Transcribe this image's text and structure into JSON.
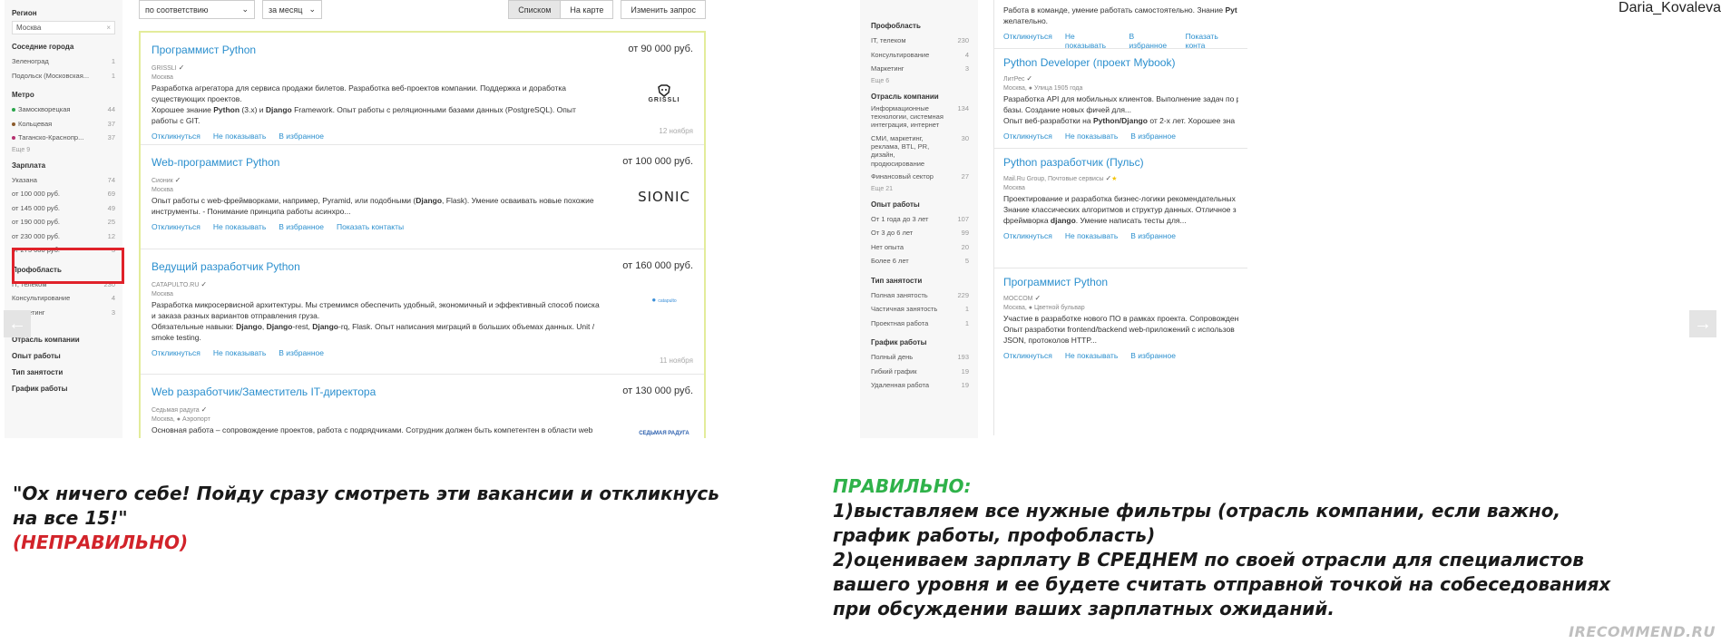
{
  "left": {
    "filters": {
      "region_title": "Регион",
      "region_value": "Москва",
      "region_clear": "×",
      "neighbors_title": "Соседние города",
      "neighbors": [
        {
          "label": "Зеленоград",
          "count": "1"
        },
        {
          "label": "Подольск (Московская...",
          "count": "1"
        }
      ],
      "metro_title": "Метро",
      "metro": [
        {
          "label": "Замоскворецкая",
          "count": "44",
          "color": "#2aa44a"
        },
        {
          "label": "Кольцевая",
          "count": "37",
          "color": "#8b5a2b"
        },
        {
          "label": "Таганско-Краснопр...",
          "count": "37",
          "color": "#b5306f"
        }
      ],
      "metro_more": "Еще 9",
      "salary_title": "Зарплата",
      "salary": [
        {
          "label": "Указана",
          "count": "74"
        },
        {
          "label": "от 100 000 руб.",
          "count": "69"
        },
        {
          "label": "от 145 000 руб.",
          "count": "49"
        },
        {
          "label": "от 190 000 руб.",
          "count": "25"
        },
        {
          "label": "от 230 000 руб.",
          "count": "12"
        },
        {
          "label": "от 275 000 руб.",
          "count": "3"
        }
      ],
      "prof_title": "Профобласть",
      "prof": [
        {
          "label": "IT, телеком",
          "count": "230"
        },
        {
          "label": "Консультирование",
          "count": "4"
        },
        {
          "label": "Маркетинг",
          "count": "3"
        }
      ],
      "prof_more": "Еще 6",
      "industry_title": "Отрасль компании",
      "experience_title": "Опыт работы",
      "employment_title": "Тип занятости",
      "schedule_title": "График работы"
    },
    "toolbar": {
      "sort": "по соответствию",
      "period": "за месяц",
      "view_list": "Списком",
      "view_map": "На карте",
      "change_query": "Изменить запрос"
    },
    "vacancies": [
      {
        "title": "Программист Python",
        "salary": "от 90 000 руб.",
        "company": "GRISSLI",
        "city": "Москва",
        "desc_html": "Разработка агрегатора для сервиса продажи билетов. Разработка веб-проектов компании. Поддержка и доработка существующих проектов.<br>Хорошее знание <b>Python</b> (3.x) и <b>Django</b> Framework. Опыт работы с реляционными базами данных (PostgreSQL). Опыт работы с GIT.",
        "actions": [
          "Откликнуться",
          "Не показывать",
          "В избранное"
        ],
        "date": "12 ноября",
        "logo": "GRISSLI"
      },
      {
        "title": "Web-программист Python",
        "salary": "от 100 000 руб.",
        "company": "Сионик",
        "city": "Москва",
        "desc_html": "Опыт работы с web-фреймворками, например, Pyramid, или подобными (<b>Django</b>, Flask). Умение осваивать новые похожие инструменты. - Понимание принципа работы асинхро...",
        "actions": [
          "Откликнуться",
          "Не показывать",
          "В избранное",
          "Показать контакты"
        ],
        "date": "",
        "logo": "SIONIC"
      },
      {
        "title": "Ведущий разработчик Python",
        "salary": "от 160 000 руб.",
        "company": "CATAPULTO.RU",
        "city": "Москва",
        "desc_html": "Разработка микросервисной архитектуры. Мы стремимся обеспечить удобный, экономичный и эффективный способ поиска и заказа разных вариантов отправления груза.<br>Обязательные навыки: <b>Django</b>, <b>Django</b>-rest, <b>Django</b>-rq, Flask. Опыт написания миграций в больших объемах данных. Unit / smoke testing.",
        "actions": [
          "Откликнуться",
          "Не показывать",
          "В избранное"
        ],
        "date": "11 ноября",
        "logo": "catapulto"
      },
      {
        "title": "Web разработчик/Заместитель IT-директора",
        "salary": "от 130 000 руб.",
        "company": "Седьмая радуга",
        "city": "Москва, ● Аэропорт",
        "desc_html": "Основная работа – сопровождение проектов, работа с подрядчиками. Сотрудник должен быть компетентен в области web",
        "actions": [],
        "date": "",
        "logo": "СЕДЬМАЯ РАДУГА"
      }
    ],
    "caption_quote": "\"Ох ничего себе! Пойду сразу смотреть эти вакансии и откликнусь на все 15!\"",
    "caption_wrong": "(НЕПРАВИЛЬНО)"
  },
  "right": {
    "filters": {
      "prof_title": "Профобласть",
      "prof": [
        {
          "label": "IT, телеком",
          "count": "230"
        },
        {
          "label": "Консультирование",
          "count": "4"
        },
        {
          "label": "Маркетинг",
          "count": "3"
        }
      ],
      "prof_more": "Еще 6",
      "industry_title": "Отрасль компании",
      "industry": [
        {
          "label": "Информационные технологии, системная интеграция, интернет",
          "count": "134"
        },
        {
          "label": "СМИ, маркетинг, реклама, BTL, PR, дизайн, продюсирование",
          "count": "30"
        },
        {
          "label": "Финансовый сектор",
          "count": "27"
        }
      ],
      "industry_more": "Еще 21",
      "experience_title": "Опыт работы",
      "experience": [
        {
          "label": "От 1 года до 3 лет",
          "count": "107"
        },
        {
          "label": "От 3 до 6 лет",
          "count": "99"
        },
        {
          "label": "Нет опыта",
          "count": "20"
        },
        {
          "label": "Более 6 лет",
          "count": "5"
        }
      ],
      "employment_title": "Тип занятости",
      "employment": [
        {
          "label": "Полная занятость",
          "count": "229"
        },
        {
          "label": "Частичная занятость",
          "count": "1"
        },
        {
          "label": "Проектная работа",
          "count": "1"
        }
      ],
      "schedule_title": "График работы",
      "schedule": [
        {
          "label": "Полный день",
          "count": "193"
        },
        {
          "label": "Гибкий график",
          "count": "19"
        },
        {
          "label": "Удаленная работа",
          "count": "19"
        }
      ]
    },
    "vacancies": [
      {
        "title": "",
        "company": "",
        "city": "",
        "desc_html": "Работа в команде, умение работать самостоятельно. Знание <b>Pyt</b><br>желательно.",
        "actions": [
          "Откликнуться",
          "Не показывать",
          "В избранное",
          "Показать конта"
        ]
      },
      {
        "title": "Python Developer (проект Mybook)",
        "company": "ЛитРес",
        "city": "Москва, ● Улица 1905 года",
        "desc_html": "Разработка API для мобильных клиентов. Выполнение задач по р<br>базы. Создание новых фичей для...<br>Опыт веб-разработки на <b>Python/Django</b> от 2-х лет. Хорошее зна",
        "actions": [
          "Откликнуться",
          "Не показывать",
          "В избранное"
        ]
      },
      {
        "title": "Python разработчик (Пульс)",
        "company": "Mail.Ru Group, Почтовые сервисы",
        "city": "Москва",
        "desc_html": "Проектирование и разработка бизнес-логики рекомендательных<br>Знание классических алгоритмов и структур данных. Отличное з<br>фреймворка <b>django</b>. Умение написать тесты для...",
        "actions": [
          "Откликнуться",
          "Не показывать",
          "В избранное"
        ]
      },
      {
        "title": "Программист Python",
        "company": "МОССОМ",
        "city": "Москва, ● Цветной бульвар",
        "desc_html": "Участие в разработке нового ПО в рамках проекта. Сопровожден<br>Опыт разработки frontend/backend web-приложений с использов<br>JSON, протоколов HTTP...",
        "actions": [
          "Откликнуться",
          "Не показывать",
          "В избранное"
        ]
      }
    ],
    "caption_correct": "ПРАВИЛЬНО:",
    "caption_line1": "1)выставляем все нужные фильтры (отрасль компании, если важно, график работы, профобласть)",
    "caption_line2": "2)оцениваем зарплату В СРЕДНЕМ по своей отрасли для специалистов вашего уровня и ее будете считать отправной точкой на собеседованиях при обсуждении ваших зарплатных ожиданий."
  },
  "author": "Daria_Kovaleva",
  "watermark": "IRECOMMEND.RU",
  "nav": {
    "prev": "←",
    "next": "→"
  },
  "colors": {
    "accent": "#2b8fce",
    "wrong": "#d2232a",
    "correct": "#2fb24a",
    "highlight": "#e0222a"
  }
}
